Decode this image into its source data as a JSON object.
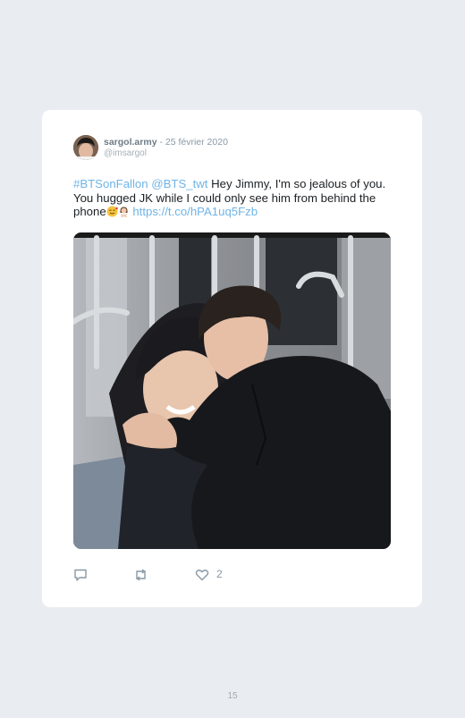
{
  "tweet": {
    "display_name": "sargol.army",
    "separator": " - ",
    "date": "25 février 2020",
    "handle": "@imsargol",
    "hashtag": "#BTSonFallon",
    "mention": "@BTS_twt",
    "text_1": " Hey Jimmy, I'm so jealous of you. You hugged JK while I could only see him from behind the phone",
    "link": "https://t.co/hPA1uq5Fzb",
    "emojis": [
      "smiling-face-with-hearts-emoji",
      "woman-gesturing-no-emoji"
    ],
    "likes": "2"
  },
  "actions": [
    "reply-icon",
    "retweet-icon",
    "like-icon"
  ],
  "page": {
    "number": "15"
  },
  "colors": {
    "background": "#e9edf1",
    "card": "#ffffff",
    "link": "#6fb4e6",
    "muted": "#8899a6"
  }
}
